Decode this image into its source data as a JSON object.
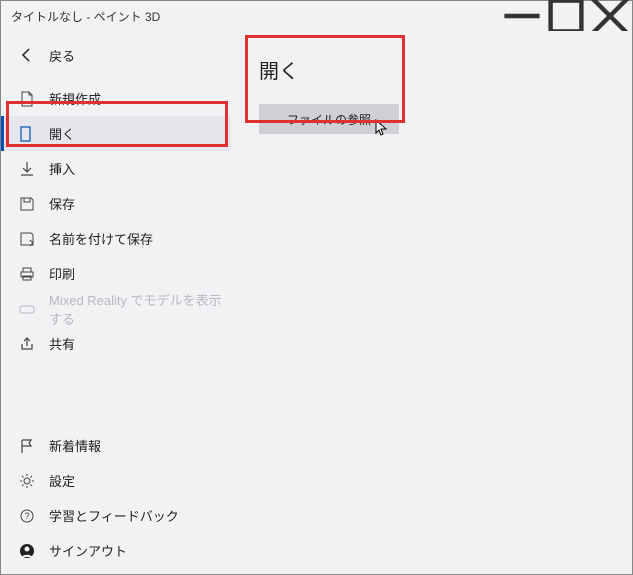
{
  "titlebar": {
    "title": "タイトルなし - ペイント 3D"
  },
  "back": {
    "label": "戻る"
  },
  "menu": {
    "items": [
      {
        "label": "新規作成"
      },
      {
        "label": "開く"
      },
      {
        "label": "挿入"
      },
      {
        "label": "保存"
      },
      {
        "label": "名前を付けて保存"
      },
      {
        "label": "印刷"
      },
      {
        "label": "Mixed Reality でモデルを表示する"
      },
      {
        "label": "共有"
      }
    ]
  },
  "bottom": {
    "items": [
      {
        "label": "新着情報"
      },
      {
        "label": "設定"
      },
      {
        "label": "学習とフィードバック"
      },
      {
        "label": "サインアウト"
      }
    ]
  },
  "content": {
    "heading": "開く",
    "browse_button": "ファイルの参照"
  }
}
